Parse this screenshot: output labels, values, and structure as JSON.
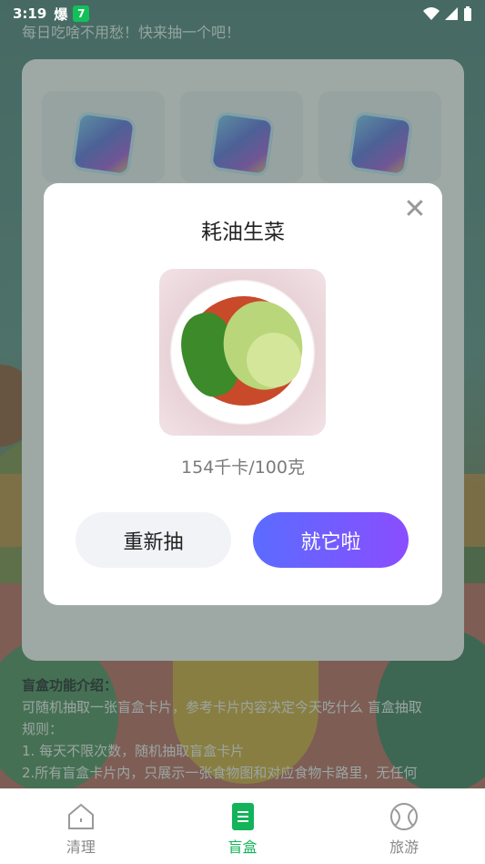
{
  "status_bar": {
    "time": "3:19",
    "app_text": "爆",
    "badge": "7"
  },
  "background": {
    "tagline": "每日吃啥不用愁！快来抽一个吧！",
    "description": {
      "heading": "盲盒功能介绍：",
      "line1": "可随机抽取一张盲盒卡片，参考卡片内容决定今天吃什么 盲盒抽取",
      "line2": "规则：",
      "line3": "1. 每天不限次数，随机抽取盲盒卡片",
      "line4": "2.所有盲盒卡片内，只展示一张食物图和对应食物卡路里，无任何"
    }
  },
  "dialog": {
    "title": "耗油生菜",
    "calories": "154千卡/100克",
    "redraw_label": "重新抽",
    "confirm_label": "就它啦",
    "close_glyph": "✕"
  },
  "tabbar": {
    "tabs": [
      {
        "label": "清理",
        "icon": "home-icon",
        "active": false
      },
      {
        "label": "盲盒",
        "icon": "document-icon",
        "active": true
      },
      {
        "label": "旅游",
        "icon": "ball-icon",
        "active": false
      }
    ]
  },
  "colors": {
    "accent_green": "#13b35a",
    "button_gradient_start": "#5b6cff",
    "button_gradient_end": "#8a4dff"
  }
}
